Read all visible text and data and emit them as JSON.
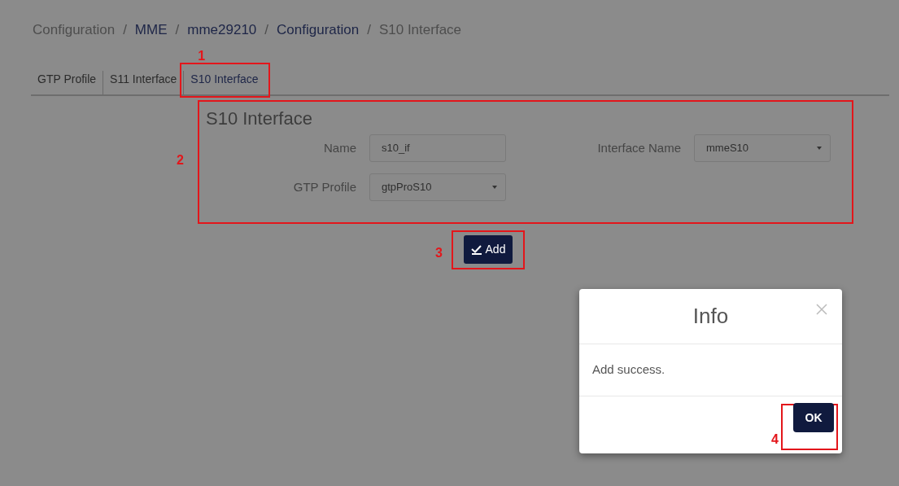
{
  "breadcrumb": [
    {
      "label": "Configuration",
      "link": false
    },
    {
      "separator": "/",
      "label": "MME",
      "link": true
    },
    {
      "separator": "/",
      "label": "mme29210",
      "link": true
    },
    {
      "separator": "/",
      "label": "Configuration",
      "link": true
    },
    {
      "separator": "/",
      "label": "S10 Interface",
      "link": false
    }
  ],
  "tabs": [
    {
      "label": "GTP Profile",
      "selected": false
    },
    {
      "label": "S11 Interface",
      "selected": false
    },
    {
      "label": "S10 Interface",
      "selected": true
    }
  ],
  "tabs_callout": "1",
  "form": {
    "callout": "2",
    "title": "S10 Interface",
    "fields": [
      {
        "label": "Name",
        "kind": "input",
        "value": "s10_if"
      },
      {
        "label": "Interface Name",
        "kind": "select",
        "value": "mmeS10"
      },
      {
        "label": "GTP Profile",
        "kind": "select",
        "value": "gtpProS10"
      }
    ]
  },
  "add_button": {
    "label": "Add",
    "callout": "3"
  },
  "dialog": {
    "title": "Info",
    "message": "Add success.",
    "ok_button": "OK",
    "ok_callout": "4"
  }
}
